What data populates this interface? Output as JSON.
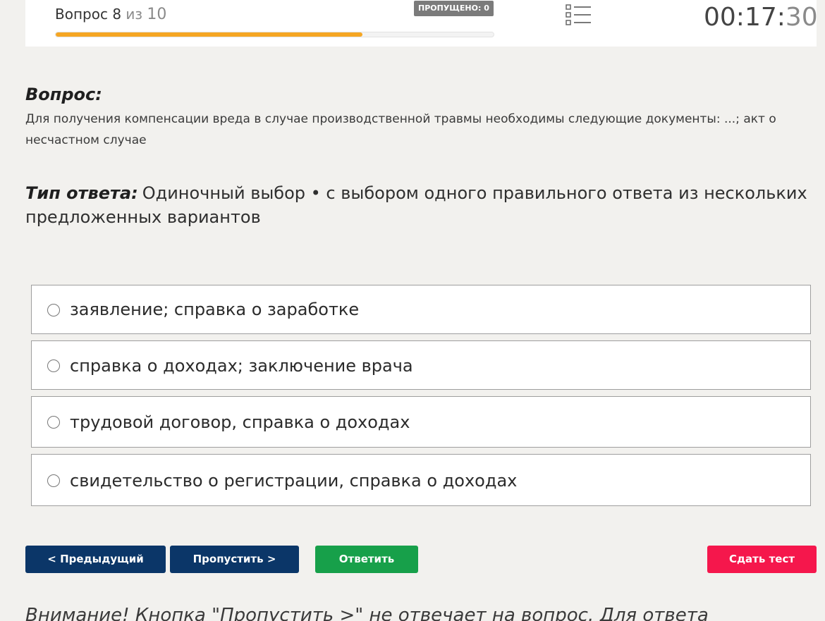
{
  "header": {
    "question_word": "Вопрос",
    "question_number": "8",
    "of_word": "из",
    "total": "10",
    "skipped_badge": "ПРОПУЩЕНО: 0",
    "progress_fraction": 0.7,
    "list_icon": "list-icon",
    "timer_hm": "00:17:",
    "timer_s": "30"
  },
  "question": {
    "heading": "Вопрос:",
    "text": "Для получения компенсации вреда в случае производственной травмы необходимы следующие документы: ...; акт о несчастном случае"
  },
  "answer_type": {
    "label": "Тип ответа:",
    "text": "Одиночный выбор • с выбором одного правильного ответа из нескольких предложенных вариантов"
  },
  "options": [
    {
      "label": "заявление; справка о заработке"
    },
    {
      "label": "справка о доходах; заключение врача"
    },
    {
      "label": "трудовой договор, справка о доходах"
    },
    {
      "label": "свидетельство о регистрации, справка о доходах"
    }
  ],
  "buttons": {
    "prev": "< Предыдущий",
    "skip": "Пропустить >",
    "answer": "Ответить",
    "submit": "Сдать тест"
  },
  "warning": "Внимание! Кнопка \"Пропустить >\" не отвечает на вопрос. Для ответа"
}
